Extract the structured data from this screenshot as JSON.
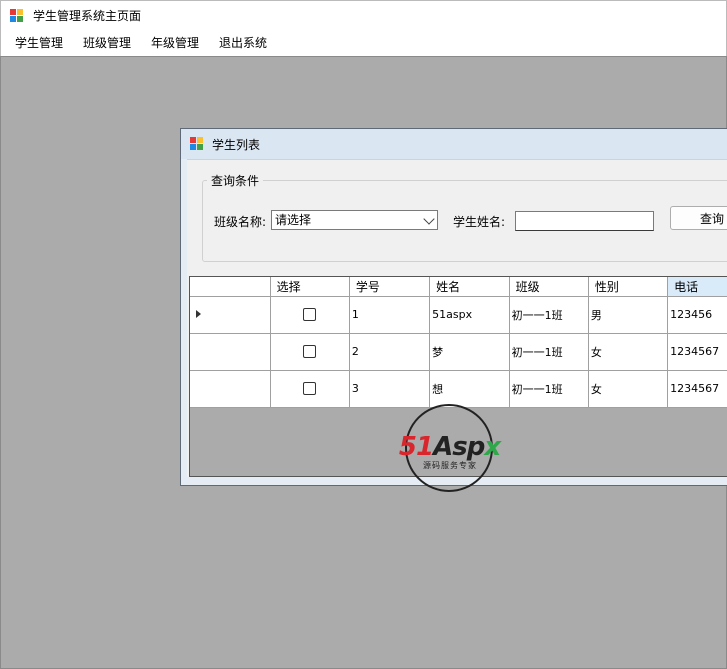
{
  "window": {
    "title": "学生管理系统主页面"
  },
  "menu": {
    "items": [
      "学生管理",
      "班级管理",
      "年级管理",
      "退出系统"
    ]
  },
  "child": {
    "title": "学生列表",
    "group": {
      "legend": "查询条件"
    },
    "class_label": "班级名称:",
    "class_combo_value": "请选择",
    "name_label": "学生姓名:",
    "name_input_value": "",
    "query_button": "查询"
  },
  "grid": {
    "headers": [
      "选择",
      "学号",
      "姓名",
      "班级",
      "性别",
      "电话"
    ],
    "rows": [
      {
        "id": "1",
        "name": "51aspx",
        "class": "初一一1班",
        "gender": "男",
        "phone": "123456",
        "checked": false
      },
      {
        "id": "2",
        "name": "梦",
        "class": "初一一1班",
        "gender": "女",
        "phone": "1234567",
        "checked": false
      },
      {
        "id": "3",
        "name": "想",
        "class": "初一一1班",
        "gender": "女",
        "phone": "1234567",
        "checked": false
      }
    ]
  },
  "watermark": {
    "part1": "51",
    "part2": "Asp",
    "part3": "x",
    "subtitle": "源码服务专家"
  },
  "colors": {
    "mdi_background": "#ababab",
    "title_bar": "#dbe6f3",
    "header_highlight": "#d9ebf9"
  }
}
